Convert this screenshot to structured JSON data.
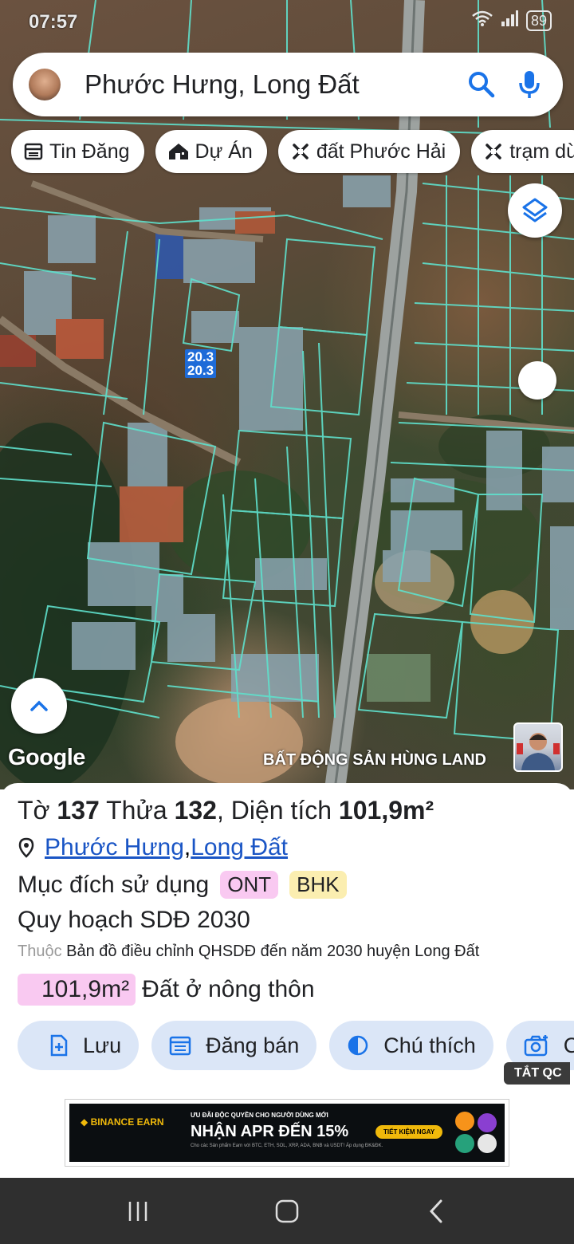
{
  "status_bar": {
    "time": "07:57",
    "battery": "89"
  },
  "search": {
    "query": "Phước Hưng, Long Đất"
  },
  "chips": [
    {
      "label": "Tin Đăng",
      "icon": "news-icon"
    },
    {
      "label": "Dự Án",
      "icon": "house-icon"
    },
    {
      "label": "đất Phước Hải",
      "icon": "tool-icon"
    },
    {
      "label": "trạm dừ",
      "icon": "tool-icon"
    }
  ],
  "map": {
    "parcel_labels": [
      "20.3",
      "20.3"
    ],
    "attribution": "Google",
    "watermark": "BẤT ĐỘNG SẢN HÙNG LAND",
    "parcel_line_color": "#5fe0cc"
  },
  "parcel": {
    "title_prefix": "Tờ ",
    "sheet_no": "137",
    "title_mid": " Thửa ",
    "lot_no": "132",
    "title_area_label": ", Diện tích ",
    "area": "101,9m²",
    "location_ward": "Phước Hưng",
    "location_sep": ", ",
    "location_district": "Long Đất",
    "purpose_label": "Mục đích sử dụng",
    "purpose_codes": [
      {
        "code": "ONT",
        "color": "#f9c9f1"
      },
      {
        "code": "BHK",
        "color": "#fbeeb0"
      }
    ],
    "planning_label": "Quy hoạch SDĐ 2030",
    "source_prefix": "Thuộc",
    "source_text": "Bản đồ điều chỉnh QHSDĐ đến năm 2030 huyện Long Đất",
    "area_value": "101,9m²",
    "area_type": "Đất ở nông thôn"
  },
  "actions": [
    {
      "label": "Lưu",
      "icon": "save-icon"
    },
    {
      "label": "Đăng bán",
      "icon": "listing-icon"
    },
    {
      "label": "Chú thích",
      "icon": "legend-icon"
    },
    {
      "label": "C",
      "icon": "camera-icon"
    }
  ],
  "ad": {
    "toggle_label": "TẮT QC",
    "brand": "BINANCE EARN",
    "subhead": "ƯU ĐÃI ĐỘC QUYỀN CHO NGƯỜI DÙNG MỚI",
    "headline": "NHẬN APR ĐẾN 15%",
    "cta": "TIẾT KIỆM NGAY",
    "fine_print": "Cho các Sản phẩm Earn với BTC, ETH, SOL, XRP, ADA, BNB và USDT! Áp dụng ĐK&ĐK."
  },
  "colors": {
    "accent": "#1a73e8",
    "sheet_button_bg": "#dbe6f7",
    "nav_bg": "#2f2f2f"
  }
}
